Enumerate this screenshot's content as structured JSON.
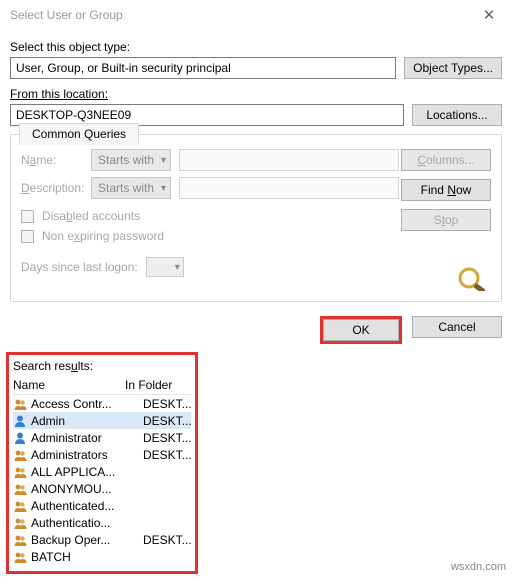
{
  "window": {
    "title": "Select User or Group",
    "close": "✕"
  },
  "objectType": {
    "label": "Select this object type:",
    "value": "User, Group, or Built-in security principal",
    "button": "Object Types..."
  },
  "location": {
    "label": "From this location:",
    "value": "DESKTOP-Q3NEE09",
    "button": "Locations..."
  },
  "queries": {
    "tab": "Common Queries",
    "nameLabel": "Name:",
    "nameMode": "Starts with",
    "descLabel": "Description:",
    "descMode": "Starts with",
    "disabledAccounts": "Disabled accounts",
    "nonExpiring": "Non expiring password",
    "daysLabel": "Days since last logon:",
    "columnsBtn": "Columns...",
    "findBtn": "Find Now",
    "stopBtn": "Stop"
  },
  "actions": {
    "ok": "OK",
    "cancel": "Cancel"
  },
  "results": {
    "label": "Search results:",
    "colName": "Name",
    "colFolder": "In Folder",
    "rows": [
      {
        "icon": "group",
        "name": "Access Contr...",
        "folder": "DESKT..."
      },
      {
        "icon": "user",
        "name": "Admin",
        "folder": "DESKT...",
        "selected": true
      },
      {
        "icon": "user",
        "name": "Administrator",
        "folder": "DESKT..."
      },
      {
        "icon": "group",
        "name": "Administrators",
        "folder": "DESKT..."
      },
      {
        "icon": "group",
        "name": "ALL APPLICA...",
        "folder": ""
      },
      {
        "icon": "group",
        "name": "ANONYMOU...",
        "folder": ""
      },
      {
        "icon": "group",
        "name": "Authenticated...",
        "folder": ""
      },
      {
        "icon": "group",
        "name": "Authenticatio...",
        "folder": ""
      },
      {
        "icon": "group",
        "name": "Backup Oper...",
        "folder": "DESKT..."
      },
      {
        "icon": "group",
        "name": "BATCH",
        "folder": ""
      }
    ]
  },
  "watermark": "wsxdn.com"
}
